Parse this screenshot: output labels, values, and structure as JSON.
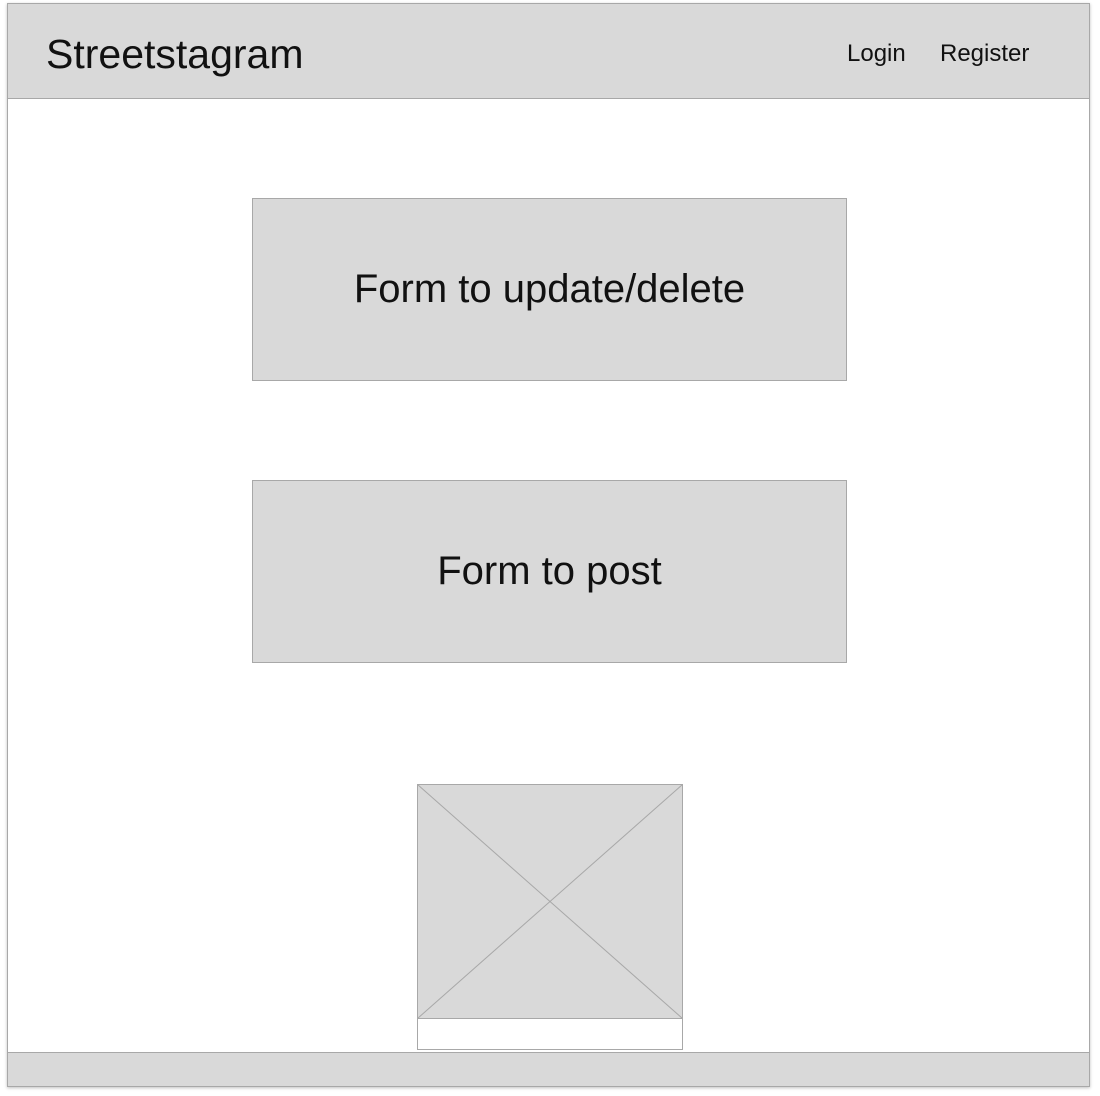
{
  "header": {
    "brand": "Streetstagram",
    "nav": {
      "login": "Login",
      "register": "Register"
    }
  },
  "main": {
    "update_delete_form": "Form to update/delete",
    "post_form": "Form to post",
    "image_placeholder_icon": "image-placeholder-icon"
  },
  "colors": {
    "panel_fill": "#d9d9d9",
    "border": "#a8a8a8",
    "page_background": "#ffffff",
    "text": "#111111"
  }
}
